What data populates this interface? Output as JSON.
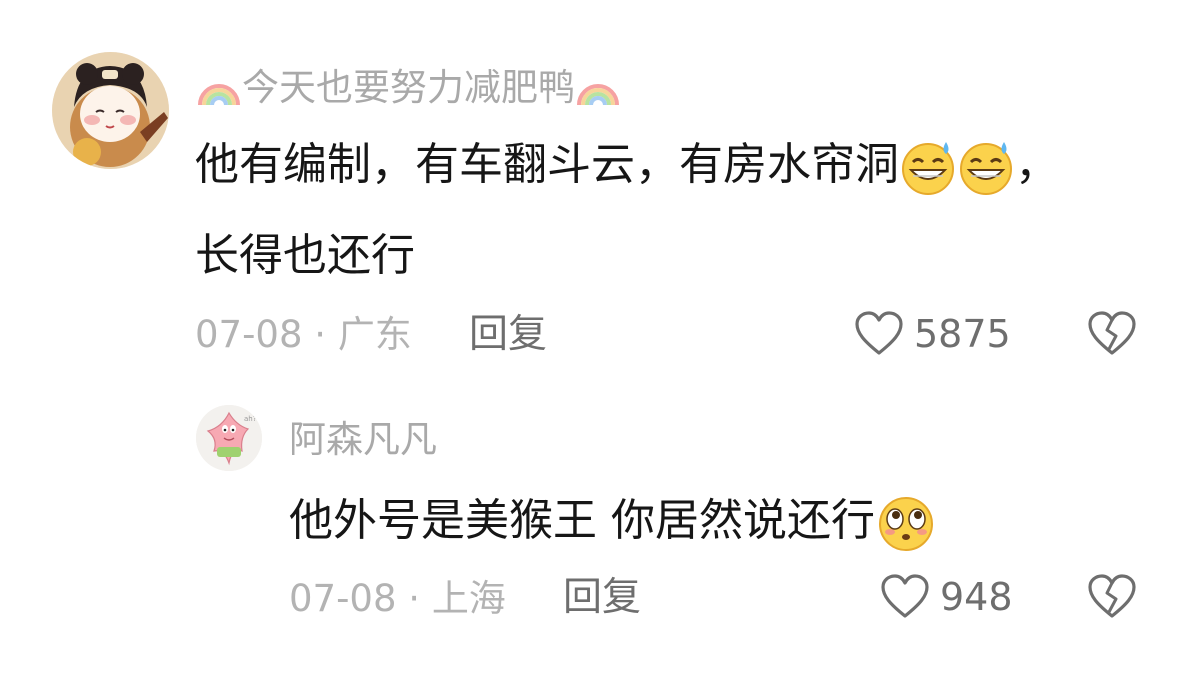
{
  "comments": [
    {
      "username": "今天也要努力减肥鸭",
      "content_line1": "他有编制，有车翻斗云，有房水帘洞",
      "content_line1_tail": "，",
      "content_line2": "长得也还行",
      "date": "07-08",
      "location": "广东",
      "reply_label": "回复",
      "like_count": "5875",
      "avatar_icon": "cartoon-girl-avatar",
      "emoji": [
        "grinning-sweat-emoji",
        "grinning-sweat-emoji"
      ]
    },
    {
      "username": "阿森凡凡",
      "content": "他外号是美猴王 你居然说还行",
      "date": "07-08",
      "location": "上海",
      "reply_label": "回复",
      "like_count": "948",
      "avatar_icon": "patrick-star-avatar",
      "emoji": [
        "flushed-emoji"
      ]
    }
  ],
  "separator": "·",
  "colors": {
    "text": "#161616",
    "muted": "#a9a9a9",
    "action": "#6e6e6e"
  }
}
